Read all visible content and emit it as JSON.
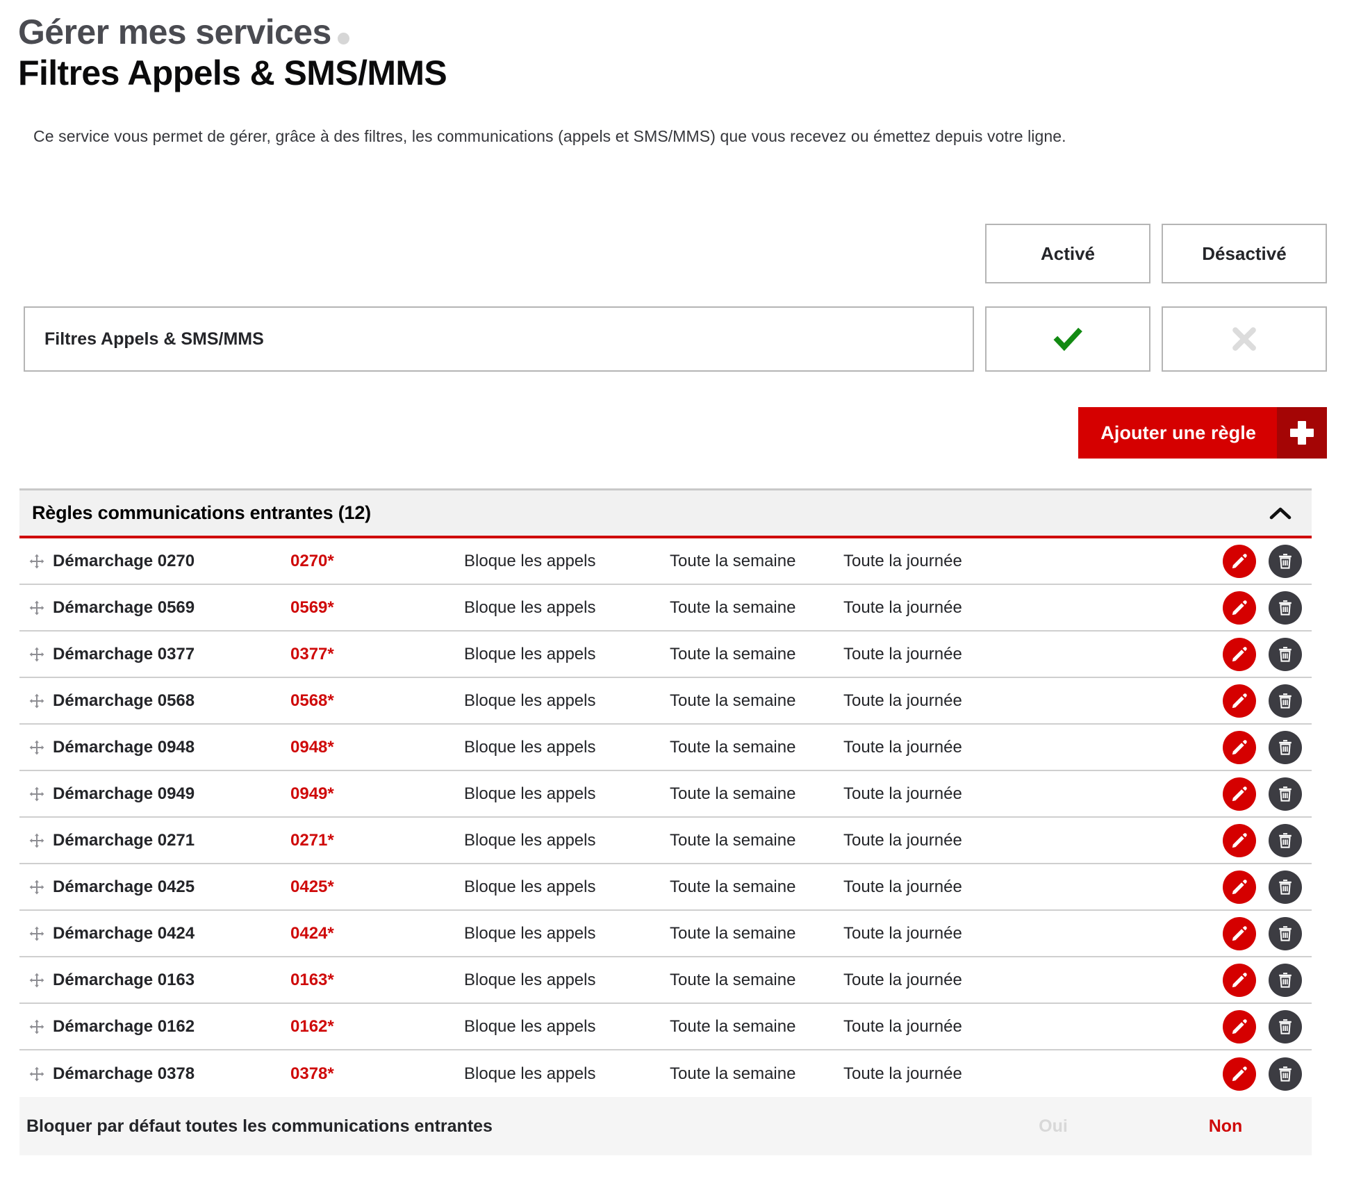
{
  "header": {
    "eyebrow": "Gérer mes services",
    "title": "Filtres Appels & SMS/MMS",
    "intro": "Ce service vous permet de gérer, grâce à des filtres, les communications (appels et SMS/MMS) que vous recevez ou émettez depuis votre ligne."
  },
  "toggle": {
    "enabled_label": "Activé",
    "disabled_label": "Désactivé",
    "service_name": "Filtres Appels & SMS/MMS",
    "state": "Activé",
    "check_icon": "check-icon",
    "cross_icon": "cross-icon",
    "check_color": "#128a12",
    "cross_color": "#dcdcdc"
  },
  "add_rule": {
    "label": "Ajouter une règle",
    "icon": "plus-icon",
    "bg_color": "#d50000",
    "icon_bg_color": "#a40505"
  },
  "panel": {
    "title": "Règles communications entrantes (12)",
    "count": 12,
    "collapse_icon": "chevron-up-icon",
    "accent_color": "#cf0a0a",
    "head_bg": "#f1f1f1"
  },
  "rules": [
    {
      "handle_icon": "move-icon",
      "name": "Démarchage 0270",
      "number": "0270*",
      "action": "Bloque les appels",
      "days": "Toute la semaine",
      "hours": "Toute la journée",
      "edit_icon": "pencil-icon",
      "delete_icon": "trash-icon"
    },
    {
      "handle_icon": "move-icon",
      "name": "Démarchage 0569",
      "number": "0569*",
      "action": "Bloque les appels",
      "days": "Toute la semaine",
      "hours": "Toute la journée",
      "edit_icon": "pencil-icon",
      "delete_icon": "trash-icon"
    },
    {
      "handle_icon": "move-icon",
      "name": "Démarchage 0377",
      "number": "0377*",
      "action": "Bloque les appels",
      "days": "Toute la semaine",
      "hours": "Toute la journée",
      "edit_icon": "pencil-icon",
      "delete_icon": "trash-icon"
    },
    {
      "handle_icon": "move-icon",
      "name": "Démarchage 0568",
      "number": "0568*",
      "action": "Bloque les appels",
      "days": "Toute la semaine",
      "hours": "Toute la journée",
      "edit_icon": "pencil-icon",
      "delete_icon": "trash-icon"
    },
    {
      "handle_icon": "move-icon",
      "name": "Démarchage 0948",
      "number": "0948*",
      "action": "Bloque les appels",
      "days": "Toute la semaine",
      "hours": "Toute la journée",
      "edit_icon": "pencil-icon",
      "delete_icon": "trash-icon"
    },
    {
      "handle_icon": "move-icon",
      "name": "Démarchage 0949",
      "number": "0949*",
      "action": "Bloque les appels",
      "days": "Toute la semaine",
      "hours": "Toute la journée",
      "edit_icon": "pencil-icon",
      "delete_icon": "trash-icon"
    },
    {
      "handle_icon": "move-icon",
      "name": "Démarchage 0271",
      "number": "0271*",
      "action": "Bloque les appels",
      "days": "Toute la semaine",
      "hours": "Toute la journée",
      "edit_icon": "pencil-icon",
      "delete_icon": "trash-icon"
    },
    {
      "handle_icon": "move-icon",
      "name": "Démarchage 0425",
      "number": "0425*",
      "action": "Bloque les appels",
      "days": "Toute la semaine",
      "hours": "Toute la journée",
      "edit_icon": "pencil-icon",
      "delete_icon": "trash-icon"
    },
    {
      "handle_icon": "move-icon",
      "name": "Démarchage 0424",
      "number": "0424*",
      "action": "Bloque les appels",
      "days": "Toute la semaine",
      "hours": "Toute la journée",
      "edit_icon": "pencil-icon",
      "delete_icon": "trash-icon"
    },
    {
      "handle_icon": "move-icon",
      "name": "Démarchage 0163",
      "number": "0163*",
      "action": "Bloque les appels",
      "days": "Toute la semaine",
      "hours": "Toute la journée",
      "edit_icon": "pencil-icon",
      "delete_icon": "trash-icon"
    },
    {
      "handle_icon": "move-icon",
      "name": "Démarchage 0162",
      "number": "0162*",
      "action": "Bloque les appels",
      "days": "Toute la semaine",
      "hours": "Toute la journée",
      "edit_icon": "pencil-icon",
      "delete_icon": "trash-icon"
    },
    {
      "handle_icon": "move-icon",
      "name": "Démarchage 0378",
      "number": "0378*",
      "action": "Bloque les appels",
      "days": "Toute la semaine",
      "hours": "Toute la journée",
      "edit_icon": "pencil-icon",
      "delete_icon": "trash-icon"
    }
  ],
  "footer": {
    "label": "Bloquer par défaut toutes les communications entrantes",
    "yes_label": "Oui",
    "no_label": "Non",
    "selected": "Non"
  }
}
